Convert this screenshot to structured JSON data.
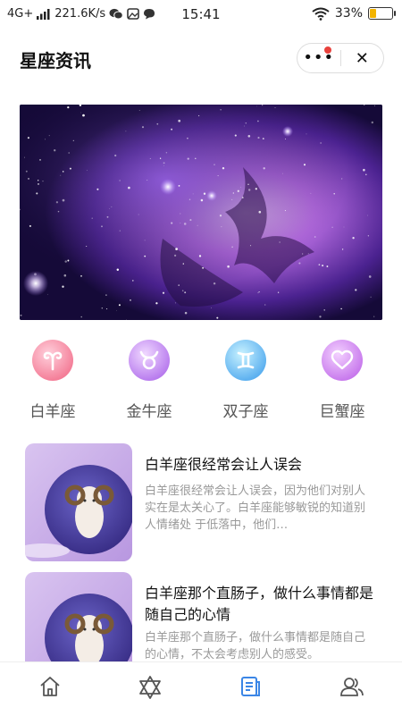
{
  "status_bar": {
    "network": "4G+",
    "speed": "221.6K/s",
    "time": "15:41",
    "battery": "33%",
    "battery_level": 0.33
  },
  "header": {
    "title": "星座资讯"
  },
  "zodiacs": [
    {
      "label": "白羊座",
      "icon": "aries-icon",
      "color": "#f06a8a"
    },
    {
      "label": "金牛座",
      "icon": "taurus-icon",
      "color": "#b06ef0"
    },
    {
      "label": "双子座",
      "icon": "gemini-icon",
      "color": "#39a8ef"
    },
    {
      "label": "巨蟹座",
      "icon": "cancer-icon",
      "color": "#c466e8"
    }
  ],
  "articles": [
    {
      "title": "白羊座很经常会让人误会",
      "summary": "白羊座很经常会让人误会，因为他们对别人实在是太关心了。白羊座能够敏锐的知道别人情绪处 于低落中，他们…"
    },
    {
      "title": "白羊座那个直肠子，做什么事情都是随自己的心情",
      "summary": "白羊座那个直肠子，做什么事情都是随自己的心情，不太会考虑别人的感受。"
    }
  ],
  "tabbar": {
    "active_color": "#3b86e6",
    "items": [
      "home-icon",
      "star-of-david-icon",
      "document-icon",
      "users-icon"
    ]
  }
}
